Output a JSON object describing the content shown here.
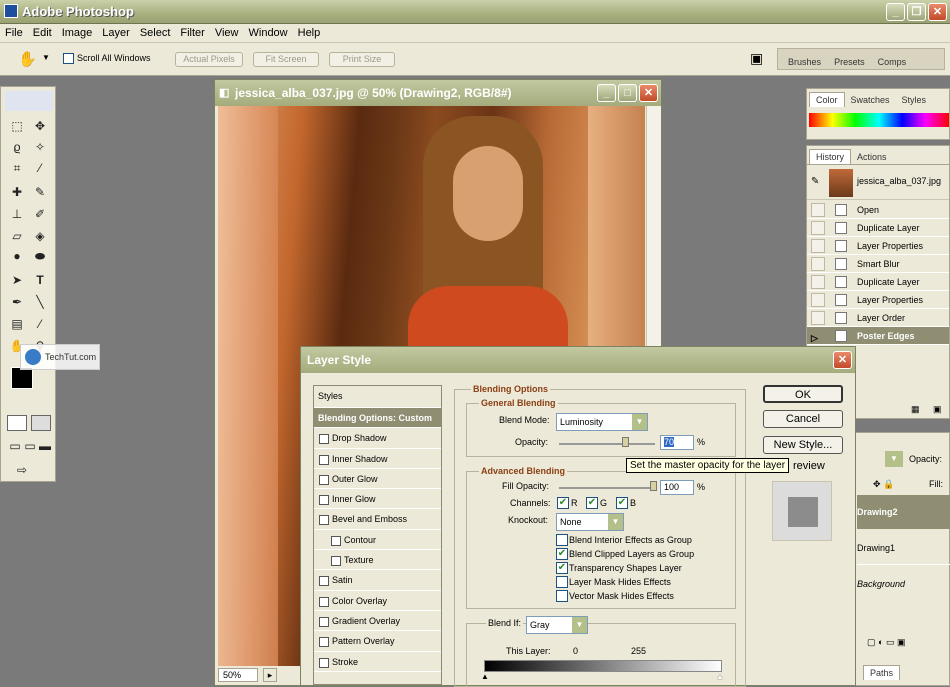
{
  "app": {
    "title": "Adobe Photoshop"
  },
  "menu": [
    "File",
    "Edit",
    "Image",
    "Layer",
    "Select",
    "Filter",
    "View",
    "Window",
    "Help"
  ],
  "options": {
    "scroll_all": "Scroll All Windows",
    "actual_pixels": "Actual Pixels",
    "fit_screen": "Fit Screen",
    "print_size": "Print Size"
  },
  "palette_well": {
    "tabs": [
      "Brushes",
      "Presets",
      "Comps"
    ]
  },
  "document": {
    "title": "jessica_alba_037.jpg @ 50% (Drawing2, RGB/8#)",
    "zoom": "50%"
  },
  "watermark": "TechTut.com",
  "color_panel": {
    "tabs": [
      "Color",
      "Swatches",
      "Styles"
    ]
  },
  "history_panel": {
    "tabs": [
      "History",
      "Actions"
    ],
    "snapshot": "jessica_alba_037.jpg",
    "items": [
      "Open",
      "Duplicate Layer",
      "Layer Properties",
      "Smart Blur",
      "Duplicate Layer",
      "Layer Properties",
      "Layer Order",
      "Poster Edges"
    ]
  },
  "layers_panel": {
    "opacity_label": "Opacity:",
    "fill_label": "Fill:",
    "layers": [
      "Drawing2",
      "Drawing1",
      "Background"
    ],
    "paths_tab": "Paths"
  },
  "dialog": {
    "title": "Layer Style",
    "styles_header": "Styles",
    "styles": [
      {
        "label": "Blending Options: Custom",
        "selected": true,
        "indent": false
      },
      {
        "label": "Drop Shadow",
        "indent": false
      },
      {
        "label": "Inner Shadow",
        "indent": false
      },
      {
        "label": "Outer Glow",
        "indent": false
      },
      {
        "label": "Inner Glow",
        "indent": false
      },
      {
        "label": "Bevel and Emboss",
        "indent": false
      },
      {
        "label": "Contour",
        "indent": true
      },
      {
        "label": "Texture",
        "indent": true
      },
      {
        "label": "Satin",
        "indent": false
      },
      {
        "label": "Color Overlay",
        "indent": false
      },
      {
        "label": "Gradient Overlay",
        "indent": false
      },
      {
        "label": "Pattern Overlay",
        "indent": false
      },
      {
        "label": "Stroke",
        "indent": false
      }
    ],
    "blending_options": "Blending Options",
    "general_blending": "General Blending",
    "blend_mode_label": "Blend Mode:",
    "blend_mode": "Luminosity",
    "opacity_label": "Opacity:",
    "opacity_value": "70",
    "opacity_slider_level": 0.7,
    "percent": "%",
    "tooltip": "Set the master opacity for the layer",
    "advanced_blending": "Advanced Blending",
    "fill_opacity_label": "Fill Opacity:",
    "fill_opacity_value": "100",
    "channels_label": "Channels:",
    "channels": [
      "R",
      "G",
      "B"
    ],
    "knockout_label": "Knockout:",
    "knockout": "None",
    "checks": [
      {
        "label": "Blend Interior Effects as Group",
        "checked": false
      },
      {
        "label": "Blend Clipped Layers as Group",
        "checked": true
      },
      {
        "label": "Transparency Shapes Layer",
        "checked": true
      },
      {
        "label": "Layer Mask Hides Effects",
        "checked": false
      },
      {
        "label": "Vector Mask Hides Effects",
        "checked": false
      }
    ],
    "blend_if_label": "Blend If:",
    "blend_if": "Gray",
    "this_layer_label": "This Layer:",
    "this_layer_min": "0",
    "this_layer_max": "255",
    "ok": "OK",
    "cancel": "Cancel",
    "new_style": "New Style...",
    "preview": "review"
  }
}
